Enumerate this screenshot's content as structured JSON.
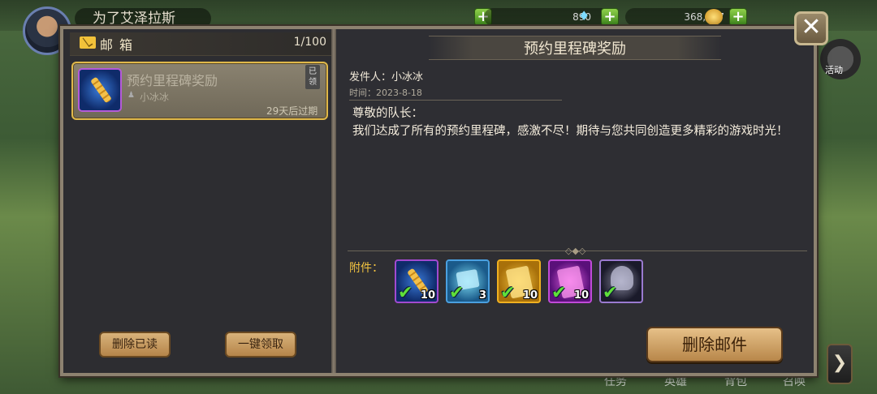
{
  "top_bar": {
    "player_name": "为了艾泽拉斯",
    "gems": "890",
    "gold": "368,727"
  },
  "side": {
    "activity_label": "活动",
    "next_arrow": "❯"
  },
  "bottom_nav": [
    "任务",
    "英雄",
    "背包",
    "召唤"
  ],
  "mailbox": {
    "title": "邮箱",
    "count": "1/100",
    "delete_read_label": "删除已读",
    "claim_all_label": "一键领取",
    "items": [
      {
        "subject": "预约里程碑奖励",
        "sender": "小冰冰",
        "expire": "29天后过期",
        "status": "已领"
      }
    ]
  },
  "detail": {
    "title": "预约里程碑奖励",
    "sender_line": "发件人：小冰冰",
    "time_line": "时间：2023-8-18",
    "body": "尊敬的队长：\n我们达成了所有的预约里程碑，感激不尽！期待与您共同创造更多精彩的游戏时光！",
    "attachments_label": "附件：",
    "attachments": [
      {
        "icon": "scroll-icon",
        "qty": "10",
        "claimed": true
      },
      {
        "icon": "ice-cube-icon",
        "qty": "3",
        "claimed": true
      },
      {
        "icon": "gold-card-icon",
        "qty": "10",
        "claimed": true
      },
      {
        "icon": "purple-card-icon",
        "qty": "10",
        "claimed": true
      },
      {
        "icon": "hero-helmet-icon",
        "qty": "",
        "claimed": true
      }
    ],
    "delete_label": "删除邮件"
  },
  "close_glyph": "✕",
  "colors": {
    "accent_gold": "#f2c340",
    "panel_bg": "#2e2e32",
    "button_tan": "#d8b27a",
    "claimed_check": "#5fe03a"
  }
}
